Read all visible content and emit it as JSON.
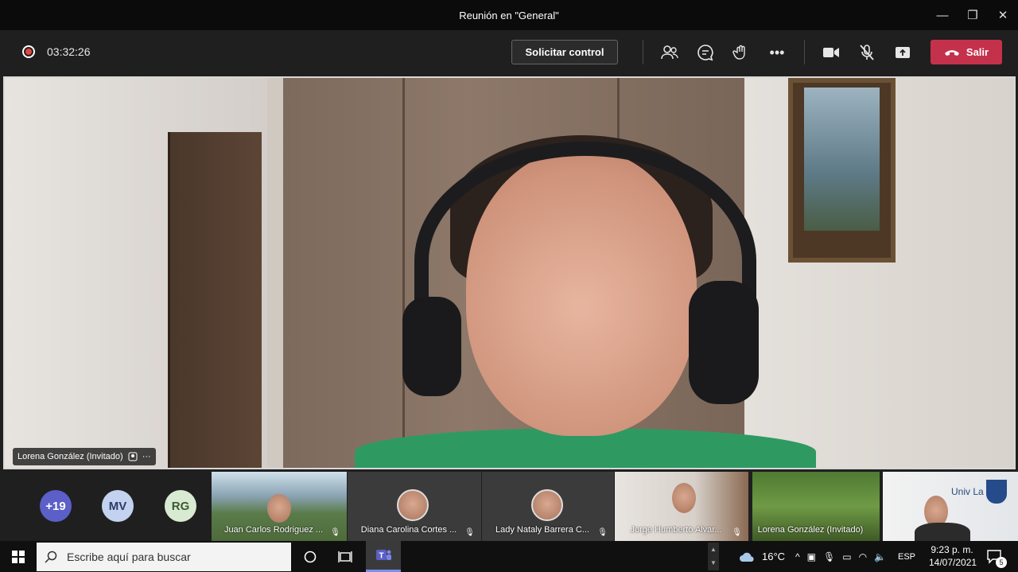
{
  "window": {
    "title": "Reunión en \"General\"",
    "minimize": "—",
    "maximize": "❐",
    "close": "✕"
  },
  "toolbar": {
    "timer": "03:32:26",
    "request_control": "Solicitar control",
    "leave": "Salir",
    "more": "•••"
  },
  "stage": {
    "name": "Lorena González (Invitado)",
    "more": "···"
  },
  "participants": {
    "overflow": "+19",
    "avatars": [
      {
        "initials": "MV",
        "bg": "#c3d2ee",
        "fg": "#2b3c6b"
      },
      {
        "initials": "RG",
        "bg": "#d9ead2",
        "fg": "#3c5a32"
      }
    ],
    "tiles": [
      {
        "name": "Juan Carlos Rodriguez ..."
      },
      {
        "name": "Diana Carolina Cortes ..."
      },
      {
        "name": "Lady Nataly Barrera C..."
      },
      {
        "name": "Jorge Humberto Alvar..."
      },
      {
        "name": "Lorena González (Invitado)"
      }
    ],
    "logo_text": "Univ La S"
  },
  "taskbar": {
    "search_placeholder": "Escribe aquí para buscar",
    "weather": "16°C",
    "language": "ESP",
    "time": "9:23 p. m.",
    "date": "14/07/2021",
    "notifications": "5"
  },
  "colors": {
    "leave": "#c4314b",
    "overflow_badge": "#5b5fc7",
    "teams_accent": "#7a8ff0"
  }
}
